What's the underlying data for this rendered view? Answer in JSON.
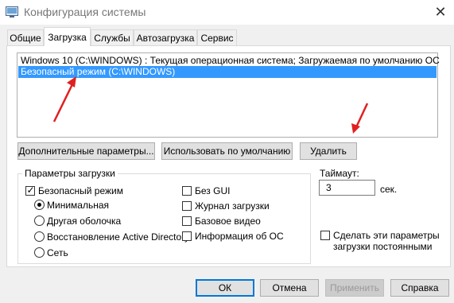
{
  "window": {
    "title": "Конфигурация системы",
    "close_glyph": "✕",
    "app_icon": "system-config-icon"
  },
  "tabs": [
    {
      "label": "Общие",
      "active": false
    },
    {
      "label": "Загрузка",
      "active": true
    },
    {
      "label": "Службы",
      "active": false
    },
    {
      "label": "Автозагрузка",
      "active": false
    },
    {
      "label": "Сервис",
      "active": false
    }
  ],
  "os_list": {
    "items": [
      {
        "label": "Windows 10 (C:\\WINDOWS) : Текущая операционная система; Загружаемая по умолчанию ОС",
        "selected": false
      },
      {
        "label": "Безопасный режим (C:\\WINDOWS)",
        "selected": true
      }
    ]
  },
  "os_buttons": {
    "advanced": "Дополнительные параметры...",
    "set_default": "Использовать по умолчанию",
    "delete": "Удалить"
  },
  "boot_options": {
    "title": "Параметры загрузки",
    "safe_boot": {
      "label": "Безопасный режим",
      "checked": true
    },
    "radios": [
      {
        "label": "Минимальная",
        "checked": true
      },
      {
        "label": "Другая оболочка",
        "checked": false
      },
      {
        "label": "Восстановление Active Directory",
        "checked": false
      },
      {
        "label": "Сеть",
        "checked": false
      }
    ],
    "right_checks": [
      {
        "label": "Без GUI",
        "checked": false
      },
      {
        "label": "Журнал загрузки",
        "checked": false
      },
      {
        "label": "Базовое видео",
        "checked": false
      },
      {
        "label": "Информация  об ОС",
        "checked": false
      }
    ]
  },
  "timeout": {
    "label": "Таймаут:",
    "value": "3",
    "unit": "сек."
  },
  "permanent": {
    "line1": "Сделать эти параметры",
    "line2": "загрузки постоянными",
    "checked": false
  },
  "footer_buttons": {
    "ok": "ОК",
    "cancel": "Отмена",
    "apply": "Применить",
    "help": "Справка"
  },
  "colors": {
    "selection": "#3399ff",
    "annotation_arrow": "#e02020",
    "button_focus": "#0078d7"
  }
}
